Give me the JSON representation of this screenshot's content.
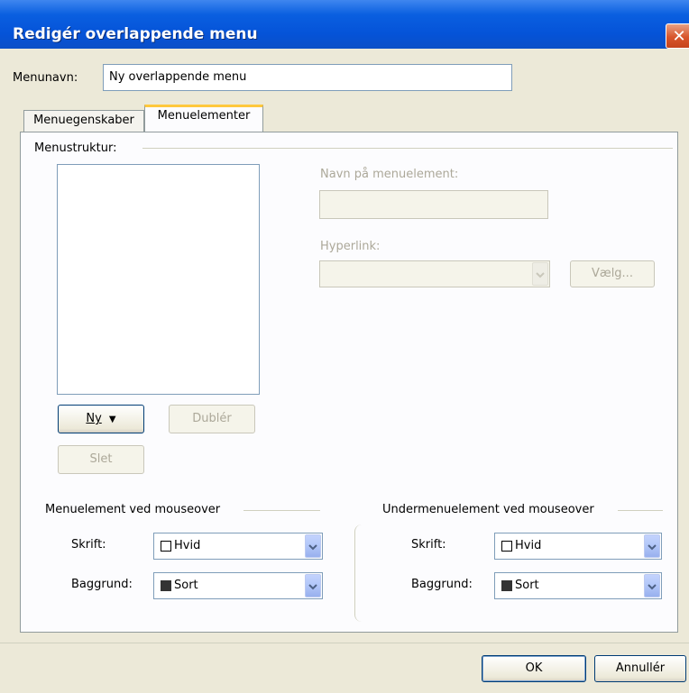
{
  "window": {
    "title": "Redigér overlappende menu",
    "close_glyph": "✕"
  },
  "menu_name": {
    "label": "Menunavn:",
    "value": "Ny overlappende menu"
  },
  "tabs": [
    {
      "label": "Menuegenskaber",
      "active": false
    },
    {
      "label": "Menuelementer",
      "active": true
    }
  ],
  "structure": {
    "label": "Menustruktur:"
  },
  "item_name": {
    "label": "Navn på menuelement:",
    "value": ""
  },
  "hyperlink": {
    "label": "Hyperlink:",
    "value": "",
    "choose_label": "Vælg..."
  },
  "buttons": {
    "new_label": "Ny",
    "new_arrow": "▼",
    "duplicate_label": "Dublér",
    "delete_label": "Slet",
    "ok_label": "OK",
    "cancel_label": "Annullér"
  },
  "mouseover_left": {
    "title": "Menuelement ved mouseover",
    "font_label": "Skrift:",
    "font_value": "Hvid",
    "bg_label": "Baggrund:",
    "bg_value": "Sort"
  },
  "mouseover_right": {
    "title": "Undermenuelement ved mouseover",
    "font_label": "Skrift:",
    "font_value": "Hvid",
    "bg_label": "Baggrund:",
    "bg_value": "Sort"
  },
  "colors": {
    "title_bar": "#0553d8",
    "accent_tab": "#ffc83c",
    "swatch_white": "#ffffff",
    "swatch_black": "#333333"
  },
  "icons": {
    "close": "close-icon",
    "dropdown": "chevron-down-icon"
  }
}
